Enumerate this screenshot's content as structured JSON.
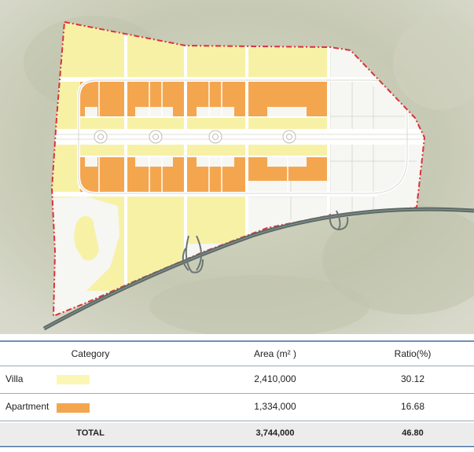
{
  "legend_table": {
    "headers": {
      "category": "Category",
      "area": "Area (m² )",
      "ratio": "Ratio(%)"
    },
    "rows": [
      {
        "category": "Villa",
        "area": "2,410,000",
        "ratio": "30.12",
        "color": "#fbf6b4"
      },
      {
        "category": "Apartment",
        "area": "1,334,000",
        "ratio": "16.68",
        "color": "#f4a64f"
      }
    ],
    "total": {
      "label": "TOTAL",
      "area": "3,744,000",
      "ratio": "46.80"
    }
  },
  "map": {
    "colors": {
      "villa": "#f7f1a6",
      "apartment": "#f4a64f",
      "unassigned": "#f7f7f5",
      "boundary": "#d9323a",
      "terrain": "#c9ccb8",
      "highway": "#5d6a66",
      "road": "#ffffff"
    },
    "icons": [
      "roundabout-icon",
      "highway-interchange-icon"
    ]
  }
}
